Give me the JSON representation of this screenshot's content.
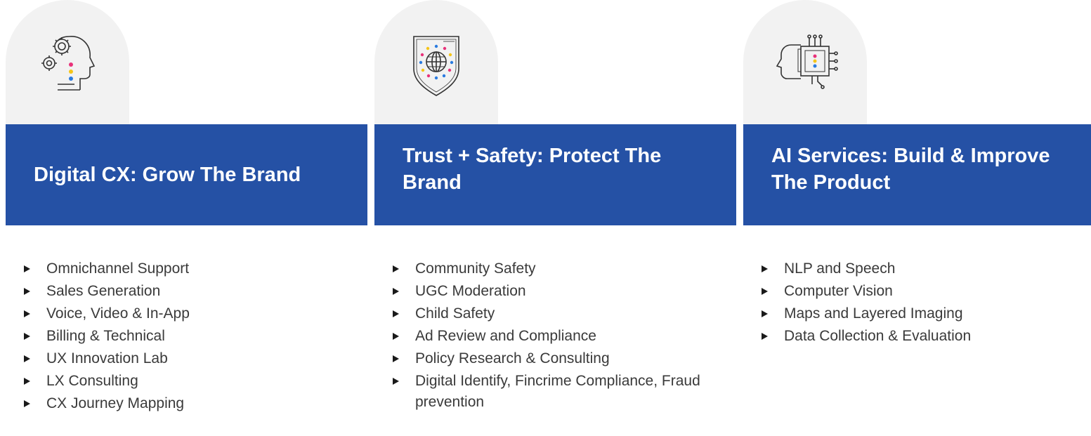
{
  "colors": {
    "header_bg": "#2551a5",
    "icon_bg": "#f2f2f2",
    "dot_pink": "#e8327a",
    "dot_yellow": "#f5c518",
    "dot_blue": "#2a7be0"
  },
  "columns": [
    {
      "icon": "head-gears-icon",
      "title": "Digital CX: Grow The Brand",
      "items": [
        "Omnichannel Support",
        "Sales Generation",
        "Voice, Video & In-App",
        "Billing & Technical",
        "UX Innovation Lab",
        "LX Consulting",
        "CX Journey Mapping"
      ]
    },
    {
      "icon": "shield-globe-icon",
      "title": "Trust + Safety: Protect The Brand",
      "items": [
        "Community Safety",
        "UGC Moderation",
        "Child Safety",
        "Ad Review and Compliance",
        "Policy Research & Consulting",
        "Digital Identify, Fincrime Compliance, Fraud prevention"
      ]
    },
    {
      "icon": "ai-head-chip-icon",
      "title": "AI Services: Build & Improve The Product",
      "items": [
        "NLP and Speech",
        "Computer Vision",
        "Maps and Layered Imaging",
        "Data Collection & Evaluation"
      ]
    }
  ]
}
